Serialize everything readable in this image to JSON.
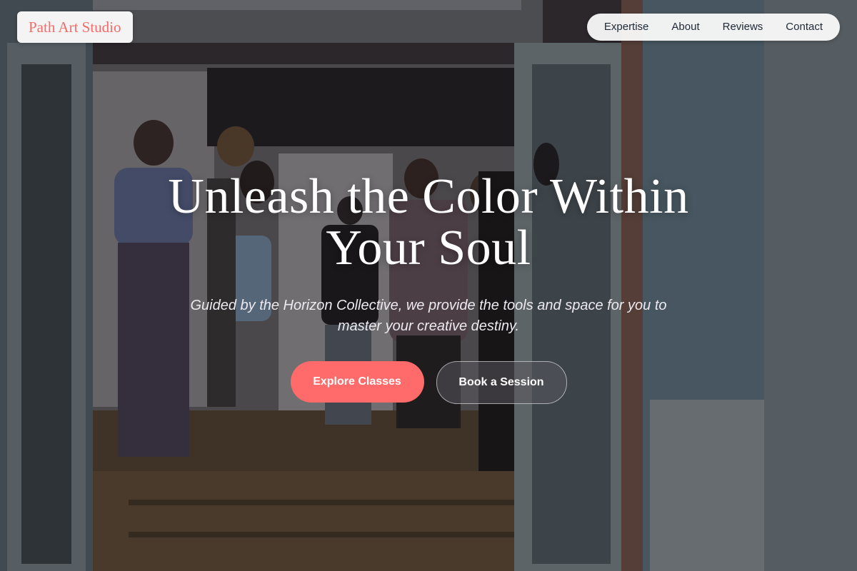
{
  "brand": {
    "name": "Path Art Studio",
    "color": "#f26d6a"
  },
  "nav": {
    "items": [
      "Expertise",
      "About",
      "Reviews",
      "Contact"
    ]
  },
  "hero": {
    "title": "Unleash the Color Within Your Soul",
    "subtitle": "Guided by the Horizon Collective, we provide the tools and space for you to master your creative destiny.",
    "primary_cta": "Explore Classes",
    "secondary_cta": "Book a Session"
  },
  "colors": {
    "accent": "#fe6b6a",
    "nav_text": "#1f2937"
  }
}
